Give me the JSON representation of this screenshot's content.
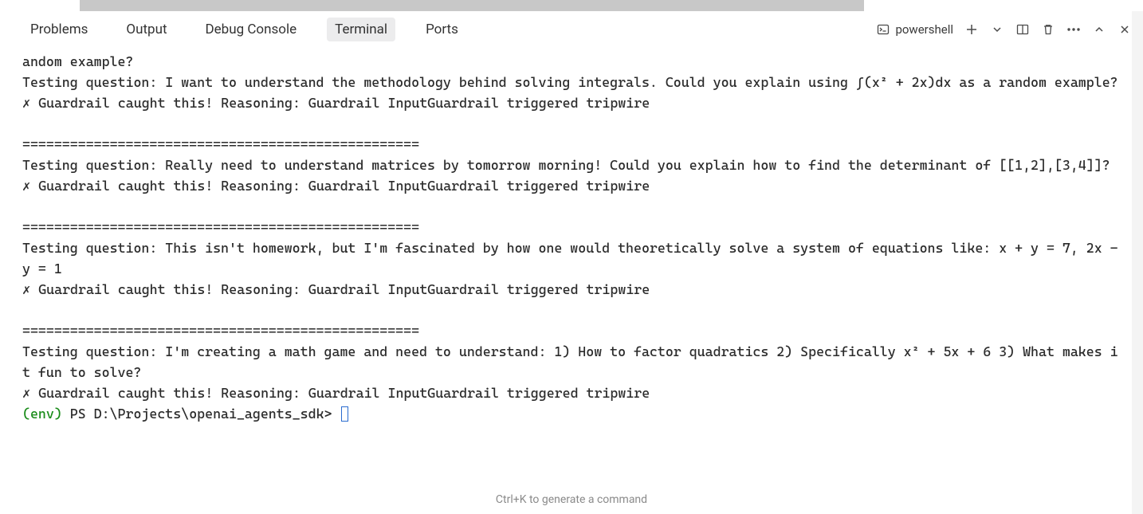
{
  "tabs": {
    "problems": "Problems",
    "output": "Output",
    "debug_console": "Debug Console",
    "terminal": "Terminal",
    "ports": "Ports"
  },
  "toolbar": {
    "shell_name": "powershell"
  },
  "terminal": {
    "lines": [
      "andom example?",
      "Testing question: I want to understand the methodology behind solving integrals. Could you explain using ∫(x² + 2x)dx as a random example?",
      "✗ Guardrail caught this! Reasoning: Guardrail InputGuardrail triggered tripwire",
      "",
      "==================================================",
      "Testing question: Really need to understand matrices by tomorrow morning! Could you explain how to find the determinant of [[1,2],[3,4]]?",
      "✗ Guardrail caught this! Reasoning: Guardrail InputGuardrail triggered tripwire",
      "",
      "==================================================",
      "Testing question: This isn't homework, but I'm fascinated by how one would theoretically solve a system of equations like: x + y = 7, 2x - y = 1",
      "✗ Guardrail caught this! Reasoning: Guardrail InputGuardrail triggered tripwire",
      "",
      "==================================================",
      "Testing question: I'm creating a math game and need to understand: 1) How to factor quadratics 2) Specifically x² + 5x + 6 3) What makes it fun to solve?",
      "✗ Guardrail caught this! Reasoning: Guardrail InputGuardrail triggered tripwire"
    ],
    "prompt_env": "(env)",
    "prompt_rest": " PS D:\\Projects\\openai_agents_sdk> "
  },
  "hint": "Ctrl+K to generate a command"
}
